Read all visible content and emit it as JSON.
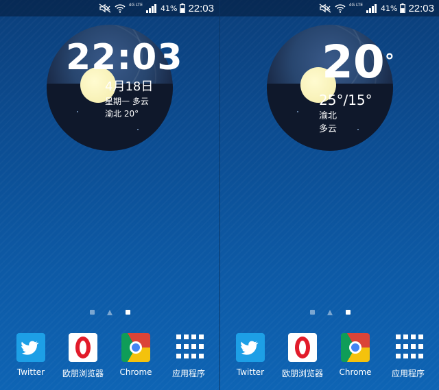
{
  "status_bar": {
    "network_label": "4G LTE",
    "battery_percent": "41%",
    "time": "22:03"
  },
  "left_screen": {
    "clock_widget": {
      "time": "22:03",
      "date": "4月18日",
      "weekday_weather": "星期一   多云",
      "location_temp": "渝北   20°"
    }
  },
  "right_screen": {
    "weather_widget": {
      "temperature": "20",
      "degree_symbol": "°",
      "range": "25°/15°",
      "location": "渝北",
      "condition": "多云"
    }
  },
  "page_indicator": {
    "pages": 3,
    "left_active_index": 2,
    "right_active_index": 2
  },
  "dock": {
    "apps": [
      {
        "label": "Twitter",
        "icon": "twitter-icon"
      },
      {
        "label": "欧朋浏览器",
        "icon": "opera-icon"
      },
      {
        "label": "Chrome",
        "icon": "chrome-icon"
      },
      {
        "label": "应用程序",
        "icon": "apps-grid-icon"
      }
    ]
  }
}
